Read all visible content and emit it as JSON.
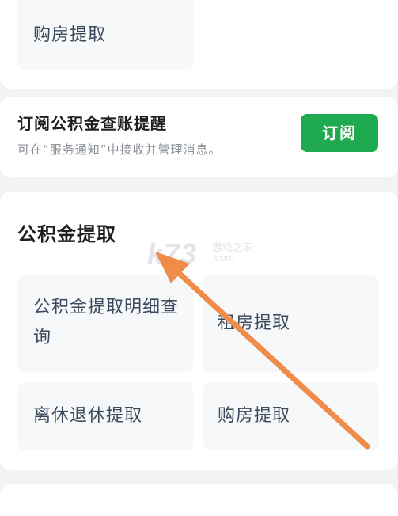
{
  "top_card": {
    "tile_label": "购房提取"
  },
  "subscribe": {
    "title": "订阅公积金查账提醒",
    "desc": "可在“服务通知”中接收并管理消息。",
    "button_label": "订阅"
  },
  "withdraw": {
    "title": "公积金提取",
    "tiles": [
      {
        "label": "公积金提取明细查询"
      },
      {
        "label": "租房提取"
      },
      {
        "label": "离休退休提取"
      },
      {
        "label": "购房提取"
      }
    ]
  },
  "watermark": {
    "logo": "k73",
    "text_cn": "游戏之家",
    "text_url": ".com"
  },
  "colors": {
    "accent_green": "#1faa4f",
    "arrow_orange": "#f08c4a",
    "background": "#f2f3f5"
  }
}
